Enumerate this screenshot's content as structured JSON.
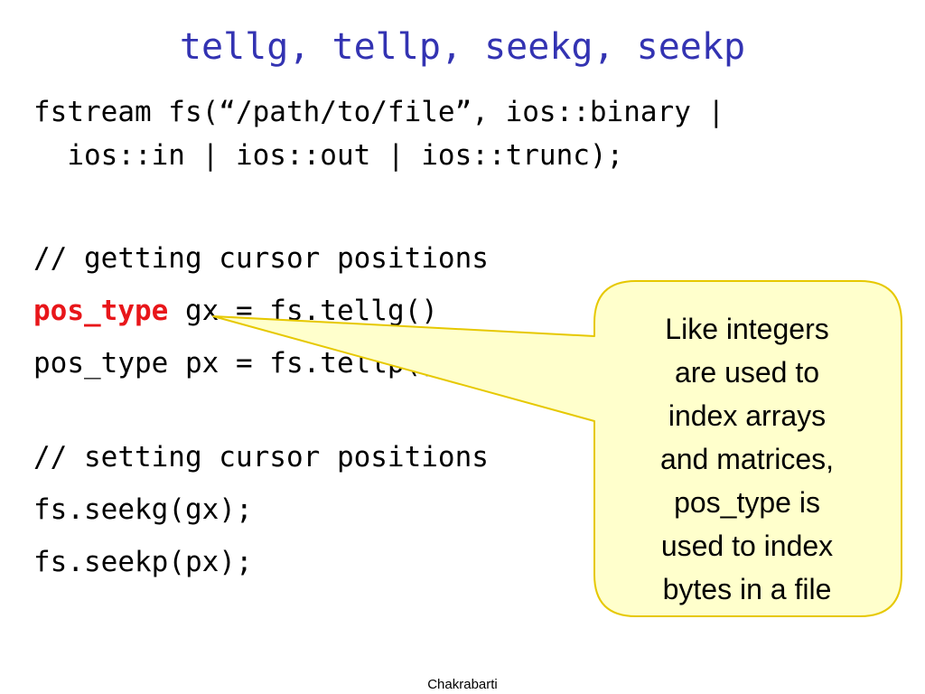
{
  "title": "tellg, tellp, seekg, seekp",
  "code": {
    "line1": "fstream fs(“/path/to/file”, ios::binary |",
    "line2": "  ios::in | ios::out | ios::trunc);",
    "comment_get": "// getting cursor positions",
    "line_pos_type_keyword": "pos_type",
    "line_gx_rest": " gx = fs.tellg()",
    "line_px": "pos_type px = fs.tellp();",
    "comment_set": "// setting cursor positions",
    "line_seekg": "fs.seekg(gx);",
    "line_seekp": "fs.seekp(px);"
  },
  "callout": {
    "lines": [
      "Like integers",
      "are used to",
      "index arrays",
      "and matrices,",
      "pos_type is",
      "used to index",
      "bytes in a file"
    ],
    "fill_color": "#ffffcc",
    "border_color": "#e6c800"
  },
  "keyword_color": "#e8161a",
  "title_color": "#3333b2",
  "footer": "Chakrabarti"
}
